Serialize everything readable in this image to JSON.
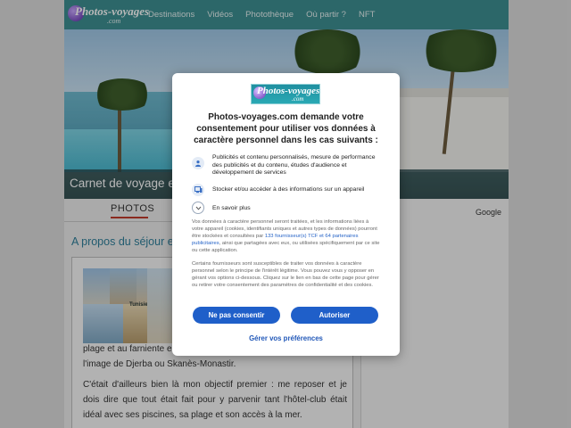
{
  "site": {
    "logo_text": "Photos-voyages",
    "logo_sub": ".com",
    "nav": [
      "Destinations",
      "Vidéos",
      "Photothèque",
      "Où partir ?",
      "NFT"
    ],
    "hero_title": "Carnet de voyage e",
    "tab_photos": "PHOTOS",
    "section_title": "A propos du séjour e",
    "google_label": "Google",
    "thumb_caption": "Tunisie",
    "text_line1": "plage et au farniente e",
    "text_line2": "l'image de Djerba ou Skanès-Monastir.",
    "text_para": "C'était d'ailleurs bien là mon objectif premier : me reposer et je dois dire que tout était fait pour y parvenir tant l'hôtel-club était idéal avec ses piscines, sa plage et son accès à la mer."
  },
  "consent": {
    "logo_text": "Photos-voyages",
    "logo_sub": ".com",
    "title": "Photos-voyages.com demande votre consentement pour utiliser vos données à caractère personnel dans les cas suivants :",
    "purposes": [
      {
        "icon": "person-icon",
        "text": "Publicités et contenu personnalisés, mesure de performance des publicités et du contenu, études d'audience et développement de services"
      },
      {
        "icon": "device-icon",
        "text": "Stocker et/ou accéder à des informations sur un appareil"
      }
    ],
    "more_label": "En savoir plus",
    "para1_before": "Vos données à caractère personnel seront traitées, et les informations liées à votre appareil (cookies, identifiants uniques et autres types de données) pourront être stockées et consultées par ",
    "para1_link": "133 fournisseur(s) TCF et 64 partenaires publicitaires",
    "para1_after": ", ainsi que partagées avec eux, ou utilisées spécifiquement par ce site ou cette application.",
    "para2": "Certains fournisseurs sont susceptibles de traiter vos données à caractère personnel selon le principe de l'intérêt légitime. Vous pouvez vous y opposer en gérant vos options ci-dessous. Cliquez sur le lien en bas de cette page pour gérer ou retirer votre consentement des paramètres de confidentialité et des cookies.",
    "refuse_label": "Ne pas consentir",
    "accept_label": "Autoriser",
    "prefs_label": "Gérer vos préférences"
  },
  "colors": {
    "nav_bg": "#3d8f92",
    "button_blue": "#1f5fc9",
    "link_blue": "#2563c7",
    "section_title": "#2f7f9a",
    "tab_underline": "#c0392b"
  }
}
